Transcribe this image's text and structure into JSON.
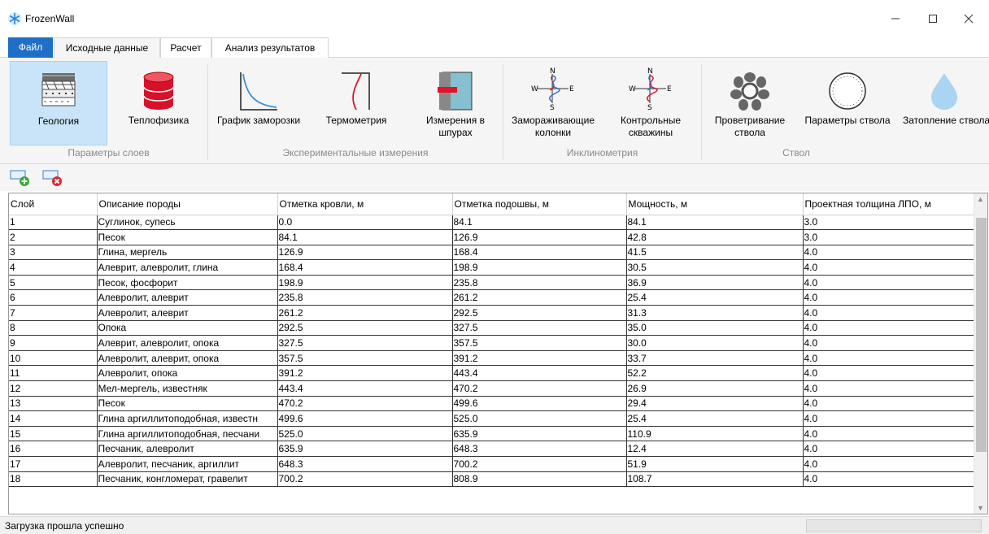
{
  "window": {
    "title": "FrozenWall"
  },
  "menu_tabs": [
    {
      "label": "Файл"
    },
    {
      "label": "Исходные данные"
    },
    {
      "label": "Расчет"
    },
    {
      "label": "Анализ результатов"
    }
  ],
  "ribbon": {
    "buttons": [
      {
        "label": "Геология",
        "icon": "geology-layers-icon"
      },
      {
        "label": "Теплофизика",
        "icon": "database-icon"
      },
      {
        "label": "График заморозки",
        "icon": "freezing-curve-icon"
      },
      {
        "label": "Термометрия",
        "icon": "thermometry-curve-icon"
      },
      {
        "label": "Измерения в шпурах",
        "icon": "borehole-measure-icon"
      },
      {
        "label": "Замораживающие колонки",
        "icon": "compass-inclinometer-icon"
      },
      {
        "label": "Контрольные скважины",
        "icon": "compass-inclinometer-icon"
      },
      {
        "label": "Проветривание ствола",
        "icon": "fan-icon"
      },
      {
        "label": "Параметры ствола",
        "icon": "shaft-ring-icon"
      },
      {
        "label": "Затопление ствола",
        "icon": "water-drop-icon"
      }
    ],
    "groups": [
      {
        "label": "Параметры слоев"
      },
      {
        "label": "Экспериментальные измерения"
      },
      {
        "label": "Инклинометрия"
      },
      {
        "label": "Ствол"
      }
    ]
  },
  "toolbar": {
    "add_icon": "add-layer-icon",
    "remove_icon": "remove-layer-icon"
  },
  "table": {
    "columns": [
      "Слой",
      "Описание породы",
      "Отметка кровли, м",
      "Отметка подошвы, м",
      "Мощность, м",
      "Проектная толщина ЛПО, м"
    ],
    "rows": [
      [
        "1",
        "Суглинок, супесь",
        "0.0",
        "84.1",
        "84.1",
        "3.0"
      ],
      [
        "2",
        "Песок",
        "84.1",
        "126.9",
        "42.8",
        "3.0"
      ],
      [
        "3",
        "Глина, мергель",
        "126.9",
        "168.4",
        "41.5",
        "4.0"
      ],
      [
        "4",
        "Алеврит, алевролит, глина",
        "168.4",
        "198.9",
        "30.5",
        "4.0"
      ],
      [
        "5",
        "Песок, фосфорит",
        "198.9",
        "235.8",
        "36.9",
        "4.0"
      ],
      [
        "6",
        "Алевролит, алеврит",
        "235.8",
        "261.2",
        "25.4",
        "4.0"
      ],
      [
        "7",
        "Алевролит, алеврит",
        "261.2",
        "292.5",
        "31.3",
        "4.0"
      ],
      [
        "8",
        "Опока",
        "292.5",
        "327.5",
        "35.0",
        "4.0"
      ],
      [
        "9",
        "Алеврит, алевролит, опока",
        "327.5",
        "357.5",
        "30.0",
        "4.0"
      ],
      [
        "10",
        "Алевролит, алеврит, опока",
        "357.5",
        "391.2",
        "33.7",
        "4.0"
      ],
      [
        "11",
        "Алевролит, опока",
        "391.2",
        "443.4",
        "52.2",
        "4.0"
      ],
      [
        "12",
        "Мел-мергель, известняк",
        "443.4",
        "470.2",
        "26.9",
        "4.0"
      ],
      [
        "13",
        "Песок",
        "470.2",
        "499.6",
        "29.4",
        "4.0"
      ],
      [
        "14",
        "Глина аргиллитоподобная, известн",
        "499.6",
        "525.0",
        "25.4",
        "4.0"
      ],
      [
        "15",
        "Глина аргиллитоподобная, песчани",
        "525.0",
        "635.9",
        "110.9",
        "4.0"
      ],
      [
        "16",
        "Песчаник, алевролит",
        "635.9",
        "648.3",
        "12.4",
        "4.0"
      ],
      [
        "17",
        "Алевролит, песчаник, аргиллит",
        "648.3",
        "700.2",
        "51.9",
        "4.0"
      ],
      [
        "18",
        "Песчаник, конгломерат, гравелит",
        "700.2",
        "808.9",
        "108.7",
        "4.0"
      ]
    ]
  },
  "status": {
    "text": "Загрузка прошла успешно"
  },
  "colors": {
    "accent": "#1e6fc5",
    "selected": "#c9e4f8"
  }
}
